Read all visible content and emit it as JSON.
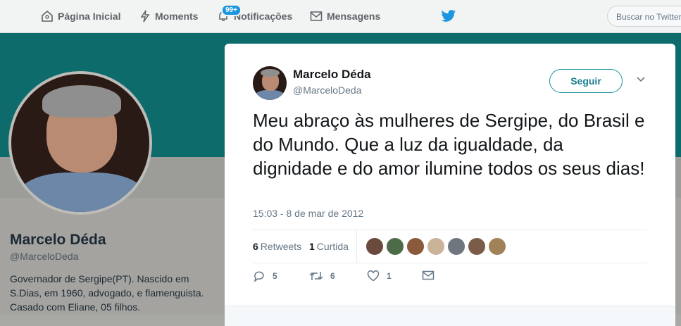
{
  "nav": {
    "home_label": "Página Inicial",
    "moments_label": "Moments",
    "notifications_label": "Notificações",
    "notifications_badge": "99+",
    "messages_label": "Mensagens",
    "search_placeholder": "Buscar no Twitter"
  },
  "profile": {
    "name": "Marcelo Déda",
    "handle": "@MarceloDeda",
    "bio": "Governador de Sergipe(PT). Nascido em S.Dias, em 1960, advogado, e flamenguista. Casado com Eliane, 05 filhos."
  },
  "tweet": {
    "author_name": "Marcelo Déda",
    "author_handle": "@MarceloDeda",
    "follow_label": "Seguir",
    "text": "Meu abraço às mulheres de Sergipe, do Brasil e do Mundo. Que a luz da igualdade, da dignidade e do amor ilumine todos os seus dias!",
    "timestamp": "15:03 - 8 de mar de 2012",
    "retweets_count": "6",
    "retweets_label": "Retweets",
    "likes_count": "1",
    "likes_label": "Curtida",
    "reply_count": "5",
    "retweet_action_count": "6",
    "like_action_count": "1"
  },
  "colors": {
    "banner": "#0d6b6b",
    "accent": "#1b95e0"
  }
}
